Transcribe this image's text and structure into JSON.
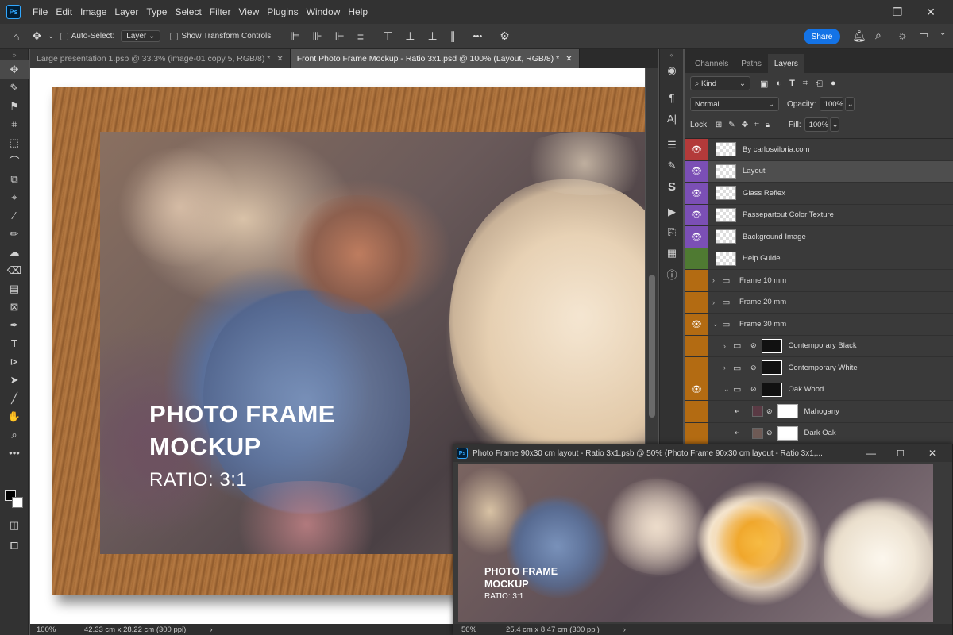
{
  "app": {
    "logo": "Ps",
    "menu": [
      "File",
      "Edit",
      "Image",
      "Layer",
      "Type",
      "Select",
      "Filter",
      "View",
      "Plugins",
      "Window",
      "Help"
    ],
    "window_controls": [
      "—",
      "❐",
      "✕"
    ]
  },
  "options_bar": {
    "auto_select_label": "Auto-Select:",
    "auto_select_target": "Layer",
    "transform_controls_label": "Show Transform Controls",
    "more_label": "•••",
    "share_label": "Share"
  },
  "tabs": [
    {
      "label": "Large presentation 1.psb @ 33.3% (image-01 copy 5, RGB/8) *",
      "close": "✕",
      "active": false
    },
    {
      "label": "Front Photo Frame Mockup - Ratio 3x1.psd @ 100% (Layout, RGB/8) *",
      "close": "✕",
      "active": true
    }
  ],
  "canvas": {
    "title_line1": "PHOTO FRAME",
    "title_line2": "MOCKUP",
    "subtitle": "RATIO: 3:1"
  },
  "status_main": {
    "zoom": "100%",
    "doc_size": "42.33 cm x 28.22 cm (300 ppi)",
    "arrow": "›"
  },
  "panel": {
    "tabs": [
      "Channels",
      "Paths",
      "Layers"
    ],
    "filter_kind": "Kind",
    "blend_mode": "Normal",
    "opacity_label": "Opacity:",
    "opacity_value": "100%",
    "lock_label": "Lock:",
    "fill_label": "Fill:",
    "fill_value": "100%",
    "layers": [
      {
        "name": "By carlosviloria.com",
        "color": "#b33a3a",
        "visible": true,
        "thumb": "checker",
        "selected": false,
        "indent": 0,
        "type": "layer"
      },
      {
        "name": "Layout",
        "color": "#7b4fb5",
        "visible": true,
        "thumb": "checker",
        "selected": true,
        "indent": 0,
        "type": "layer"
      },
      {
        "name": "Glass Reflex",
        "color": "#7b4fb5",
        "visible": true,
        "thumb": "checker",
        "selected": false,
        "indent": 0,
        "type": "layer"
      },
      {
        "name": "Passepartout Color Texture",
        "color": "#7b4fb5",
        "visible": true,
        "thumb": "checker",
        "selected": false,
        "indent": 0,
        "type": "layer"
      },
      {
        "name": "Background Image",
        "color": "#7b4fb5",
        "visible": true,
        "thumb": "checker",
        "selected": false,
        "indent": 0,
        "type": "layer"
      },
      {
        "name": "Help Guide",
        "color": "#4f7a32",
        "visible": false,
        "thumb": "checker",
        "selected": false,
        "indent": 0,
        "type": "layer"
      },
      {
        "name": "Frame 10 mm",
        "color": "#b36b12",
        "visible": false,
        "thumb": "none",
        "selected": false,
        "indent": 0,
        "type": "folder",
        "arrow": "›"
      },
      {
        "name": "Frame 20 mm",
        "color": "#b36b12",
        "visible": false,
        "thumb": "none",
        "selected": false,
        "indent": 0,
        "type": "folder",
        "arrow": "›"
      },
      {
        "name": "Frame 30 mm",
        "color": "#b36b12",
        "visible": true,
        "thumb": "none",
        "selected": false,
        "indent": 0,
        "type": "folder",
        "arrow": "⌄"
      },
      {
        "name": "Contemporary Black",
        "color": "#b36b12",
        "visible": false,
        "thumb": "dark",
        "selected": false,
        "indent": 1,
        "type": "folder",
        "arrow": "›"
      },
      {
        "name": "Contemporary White",
        "color": "#b36b12",
        "visible": false,
        "thumb": "dark",
        "selected": false,
        "indent": 1,
        "type": "folder",
        "arrow": "›"
      },
      {
        "name": "Oak Wood",
        "color": "#b36b12",
        "visible": true,
        "thumb": "dark",
        "selected": false,
        "indent": 1,
        "type": "folder",
        "arrow": "⌄"
      },
      {
        "name": "Mahogany",
        "color": "#b36b12",
        "visible": false,
        "thumb": "white",
        "swatch": "#5a3a44",
        "selected": false,
        "indent": 2,
        "type": "fill"
      },
      {
        "name": "Dark Oak",
        "color": "#b36b12",
        "visible": false,
        "thumb": "white",
        "swatch": "#6e5a55",
        "selected": false,
        "indent": 2,
        "type": "fill"
      }
    ]
  },
  "float_window": {
    "title": "Photo Frame 90x30 cm layout - Ratio 3x1.psb @ 50% (Photo Frame 90x30 cm layout - Ratio 3x1,...",
    "title_line1": "PHOTO FRAME",
    "title_line2": "MOCKUP",
    "subtitle": "RATIO: 3:1",
    "zoom": "50%",
    "doc_size": "25.4 cm x 8.47 cm (300 ppi)",
    "arrow": "›",
    "controls": [
      "—",
      "☐",
      "✕"
    ]
  }
}
